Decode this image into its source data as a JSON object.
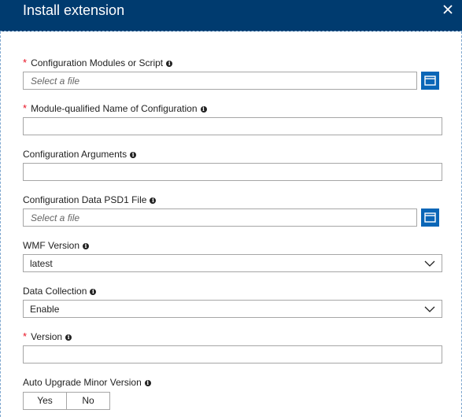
{
  "header": {
    "title": "Install extension",
    "close_icon": "close-icon"
  },
  "fields": {
    "modules": {
      "label": "Configuration Modules or Script",
      "required": true,
      "placeholder": "Select a file"
    },
    "module_name": {
      "label": "Module-qualified Name of Configuration",
      "required": true,
      "value": ""
    },
    "arguments": {
      "label": "Configuration Arguments",
      "required": false,
      "value": ""
    },
    "psd1": {
      "label": "Configuration Data PSD1 File",
      "required": false,
      "placeholder": "Select a file"
    },
    "wmf": {
      "label": "WMF Version",
      "value": "latest"
    },
    "data_collection": {
      "label": "Data Collection",
      "value": "Enable"
    },
    "version": {
      "label": "Version",
      "required": true,
      "value": ""
    },
    "auto_upgrade": {
      "label": "Auto Upgrade Minor Version",
      "options": [
        "Yes",
        "No"
      ]
    }
  },
  "required_mark": "*",
  "info_glyph": "i",
  "colors": {
    "header_bg": "#003b6f",
    "accent": "#0a66b7",
    "required": "#e81123"
  }
}
